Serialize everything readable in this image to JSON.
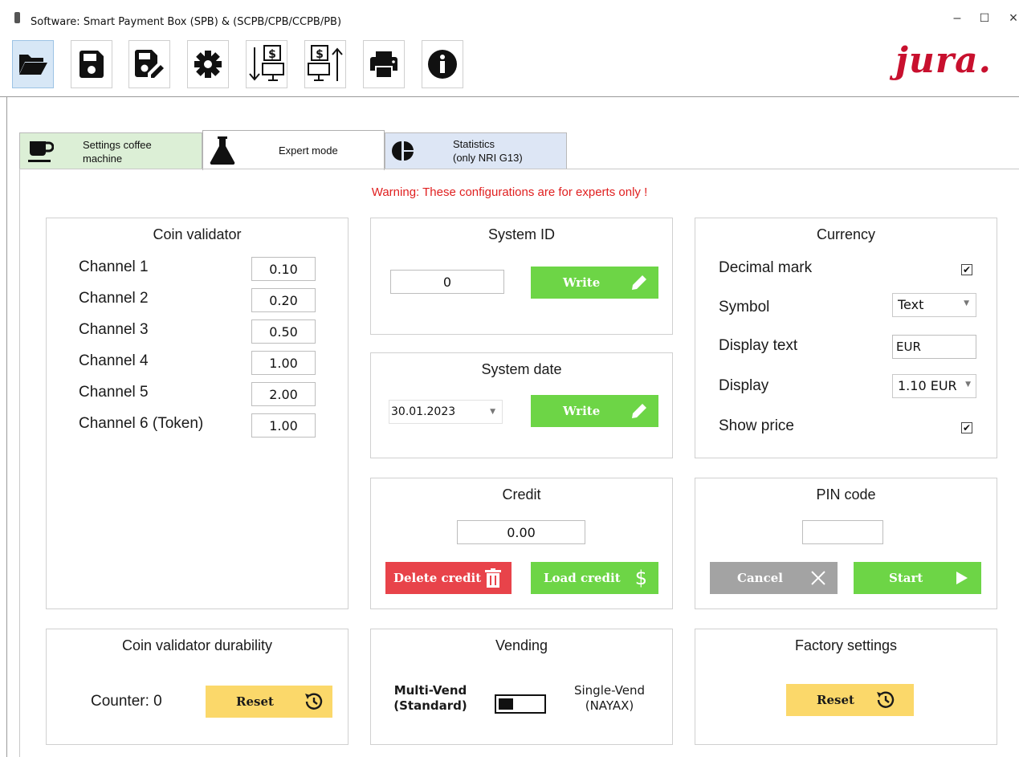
{
  "window": {
    "title": "Software: Smart Payment Box (SPB) & (SCPB/CPB/CCPB/PB)",
    "minimize_glyph": "–",
    "maximize_glyph": "☐",
    "close_glyph": "×"
  },
  "toolbar": {
    "buttons": [
      {
        "icon": "folder-open-icon",
        "active": true
      },
      {
        "icon": "save-icon"
      },
      {
        "icon": "save-as-icon"
      },
      {
        "icon": "gear-icon"
      },
      {
        "icon": "download-to-device-icon"
      },
      {
        "icon": "upload-from-device-icon"
      },
      {
        "icon": "printer-icon"
      },
      {
        "icon": "info-icon"
      }
    ],
    "logo": "jura."
  },
  "tabs": [
    {
      "label_line1": "Settings coffee",
      "label_line2": "machine",
      "icon": "coffee-cup-icon",
      "color": "#dcefd6"
    },
    {
      "label": "Expert mode",
      "icon": "flask-icon",
      "active": true
    },
    {
      "label_line1": "Statistics",
      "label_line2": "(only NRI G13)",
      "icon": "pie-chart-icon",
      "color": "#dde6f5"
    }
  ],
  "warning": "Warning: These configurations are for experts only !",
  "coin_validator": {
    "title": "Coin validator",
    "channels": [
      {
        "label": "Channel 1",
        "value": "0.10"
      },
      {
        "label": "Channel 2",
        "value": "0.20"
      },
      {
        "label": "Channel 3",
        "value": "0.50"
      },
      {
        "label": "Channel 4",
        "value": "1.00"
      },
      {
        "label": "Channel 5",
        "value": "2.00"
      },
      {
        "label": "Channel 6 (Token)",
        "value": "1.00"
      }
    ]
  },
  "system_id": {
    "title": "System ID",
    "value": "0",
    "write_label": "Write"
  },
  "system_date": {
    "title": "System date",
    "value": "30.01.2023",
    "write_label": "Write"
  },
  "credit": {
    "title": "Credit",
    "value": "0.00",
    "delete_label": "Delete credit",
    "load_label": "Load credit"
  },
  "currency": {
    "title": "Currency",
    "decimal_mark_label": "Decimal mark",
    "decimal_mark_checked": true,
    "symbol_label": "Symbol",
    "symbol_value": "Text",
    "display_text_label": "Display text",
    "display_text_value": "EUR",
    "display_label": "Display",
    "display_value": "1.10 EUR",
    "show_price_label": "Show price",
    "show_price_checked": true
  },
  "pin_code": {
    "title": "PIN code",
    "value": "",
    "cancel_label": "Cancel",
    "start_label": "Start"
  },
  "durability": {
    "title": "Coin validator durability",
    "counter_text": "Counter: 0",
    "reset_label": "Reset"
  },
  "vending": {
    "title": "Vending",
    "left_line1": "Multi-Vend",
    "left_line2": "(Standard)",
    "right_line1": "Single-Vend",
    "right_line2": "(NAYAX)",
    "state": "multi"
  },
  "factory": {
    "title": "Factory settings",
    "reset_label": "Reset"
  },
  "colors": {
    "accent_green": "#6dd546",
    "danger_red": "#e8434a",
    "neutral_gray": "#a3a3a3",
    "reset_yellow": "#fbd86a",
    "brand_red": "#c8102e",
    "warning_red": "#e02020"
  }
}
